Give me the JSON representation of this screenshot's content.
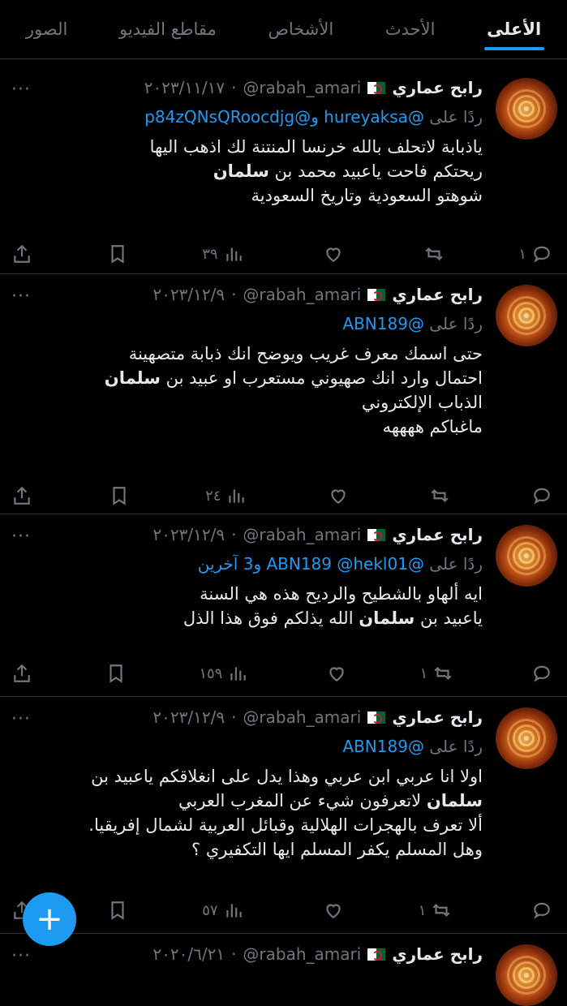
{
  "tabs": [
    {
      "label": "الأعلى",
      "active": true
    },
    {
      "label": "الأحدث",
      "active": false
    },
    {
      "label": "الأشخاص",
      "active": false
    },
    {
      "label": "مقاطع الفيديو",
      "active": false
    },
    {
      "label": "الصور",
      "active": false
    }
  ],
  "tweets": [
    {
      "name": "رابح عماري",
      "handle": "@rabah_amari",
      "date": "٢٠٢٣/١١/١٧",
      "reply_prefix": "ردًا على",
      "reply_to": "@hureyaksa و@p84zQNsQRoocdjg",
      "lines": [
        "ياذبابة لاتحلف بالله خرنسا المنتنة لك اذهب اليها",
        "ريحتكم فاحت ياعبيد محمد بن سلمان",
        "شوهتو السعودية وتاريخ السعودية"
      ],
      "replies": "١",
      "retweets": "",
      "likes": "",
      "views": "٣٩"
    },
    {
      "name": "رابح عماري",
      "handle": "@rabah_amari",
      "date": "٢٠٢٣/١٢/٩",
      "reply_prefix": "ردًا على",
      "reply_to": "@ABN189",
      "lines": [
        "حتى اسمك معرف غريب ويوضح انك ذبابة متصهينة",
        "احتمال وارد انك صهيوني مستعرب او عبيد بن سلمان",
        "الذباب الإلكتروني",
        "ماغباكم ههههه"
      ],
      "replies": "",
      "retweets": "",
      "likes": "",
      "views": "٢٤"
    },
    {
      "name": "رابح عماري",
      "handle": "@rabah_amari",
      "date": "٢٠٢٣/١٢/٩",
      "reply_prefix": "ردًا على",
      "reply_to": "@ABN189 @hekl01 و3 آخرين",
      "lines": [
        "ايه ألهاو بالشطيح والرديح هذه هي السنة",
        "ياعبيد بن سلمان الله يذلكم فوق هذا الذل"
      ],
      "replies": "",
      "retweets": "١",
      "likes": "",
      "views": "١٥٩"
    },
    {
      "name": "رابح عماري",
      "handle": "@rabah_amari",
      "date": "٢٠٢٣/١٢/٩",
      "reply_prefix": "ردًا على",
      "reply_to": "@ABN189",
      "lines": [
        "اولا انا عربي ابن عربي وهذا يدل على انغلاقكم ياعبيد بن",
        "سلمان لاتعرفون  شيء عن المغرب العربي",
        "ألا تعرف بالهجرات الهلالية وقبائل العربية لشمال إفريقيا.",
        "وهل المسلم يكفر المسلم ايها التكفيري ؟"
      ],
      "replies": "",
      "retweets": "١",
      "likes": "",
      "views": "٥٧"
    },
    {
      "name": "رابح عماري",
      "handle": "@rabah_amari",
      "date": "٢٠٢٠/٦/٢١"
    }
  ],
  "highlight_word": "سلمان",
  "fab_label": "+",
  "more_glyph": "···",
  "icons": {
    "reply": "reply-icon",
    "retweet": "retweet-icon",
    "like": "like-icon",
    "views": "views-icon",
    "bookmark": "bookmark-icon",
    "share": "share-icon"
  }
}
